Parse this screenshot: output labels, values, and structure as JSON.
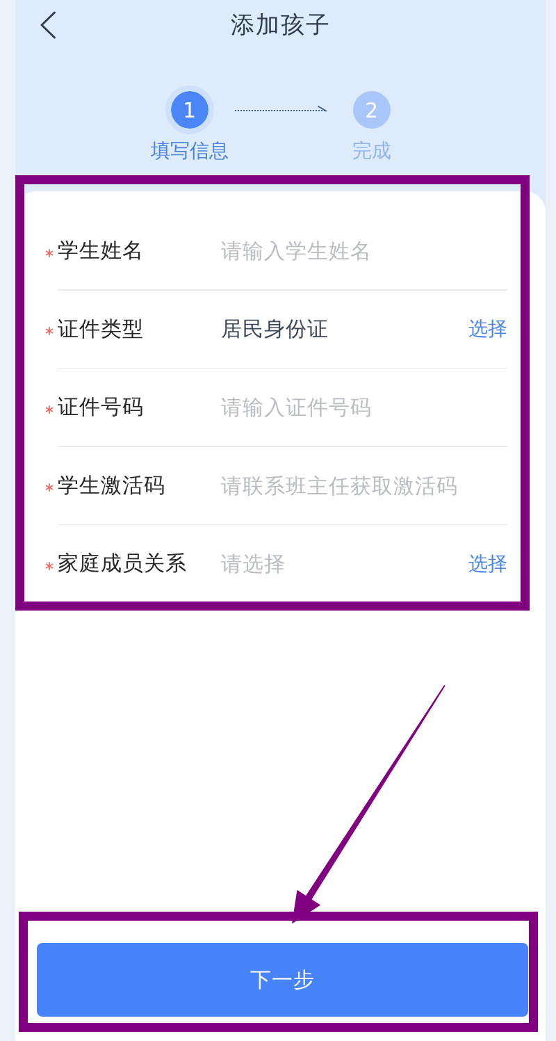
{
  "header": {
    "title": "添加孩子"
  },
  "steps": [
    {
      "number": "1",
      "label": "填写信息",
      "active": true
    },
    {
      "number": "2",
      "label": "完成",
      "active": false
    }
  ],
  "form": {
    "fields": [
      {
        "kind": "input",
        "label": "学生姓名",
        "required": true,
        "placeholder": "请输入学生姓名"
      },
      {
        "kind": "select",
        "label": "证件类型",
        "required": true,
        "value": "居民身份证",
        "action": "选择"
      },
      {
        "kind": "input",
        "label": "证件号码",
        "required": true,
        "placeholder": "请输入证件号码"
      },
      {
        "kind": "input",
        "label": "学生激活码",
        "required": true,
        "placeholder": "请联系班主任获取激活码"
      },
      {
        "kind": "select",
        "label": "家庭成员关系",
        "required": true,
        "placeholder": "请选择",
        "action": "选择"
      }
    ]
  },
  "button": {
    "label": "下一步"
  }
}
